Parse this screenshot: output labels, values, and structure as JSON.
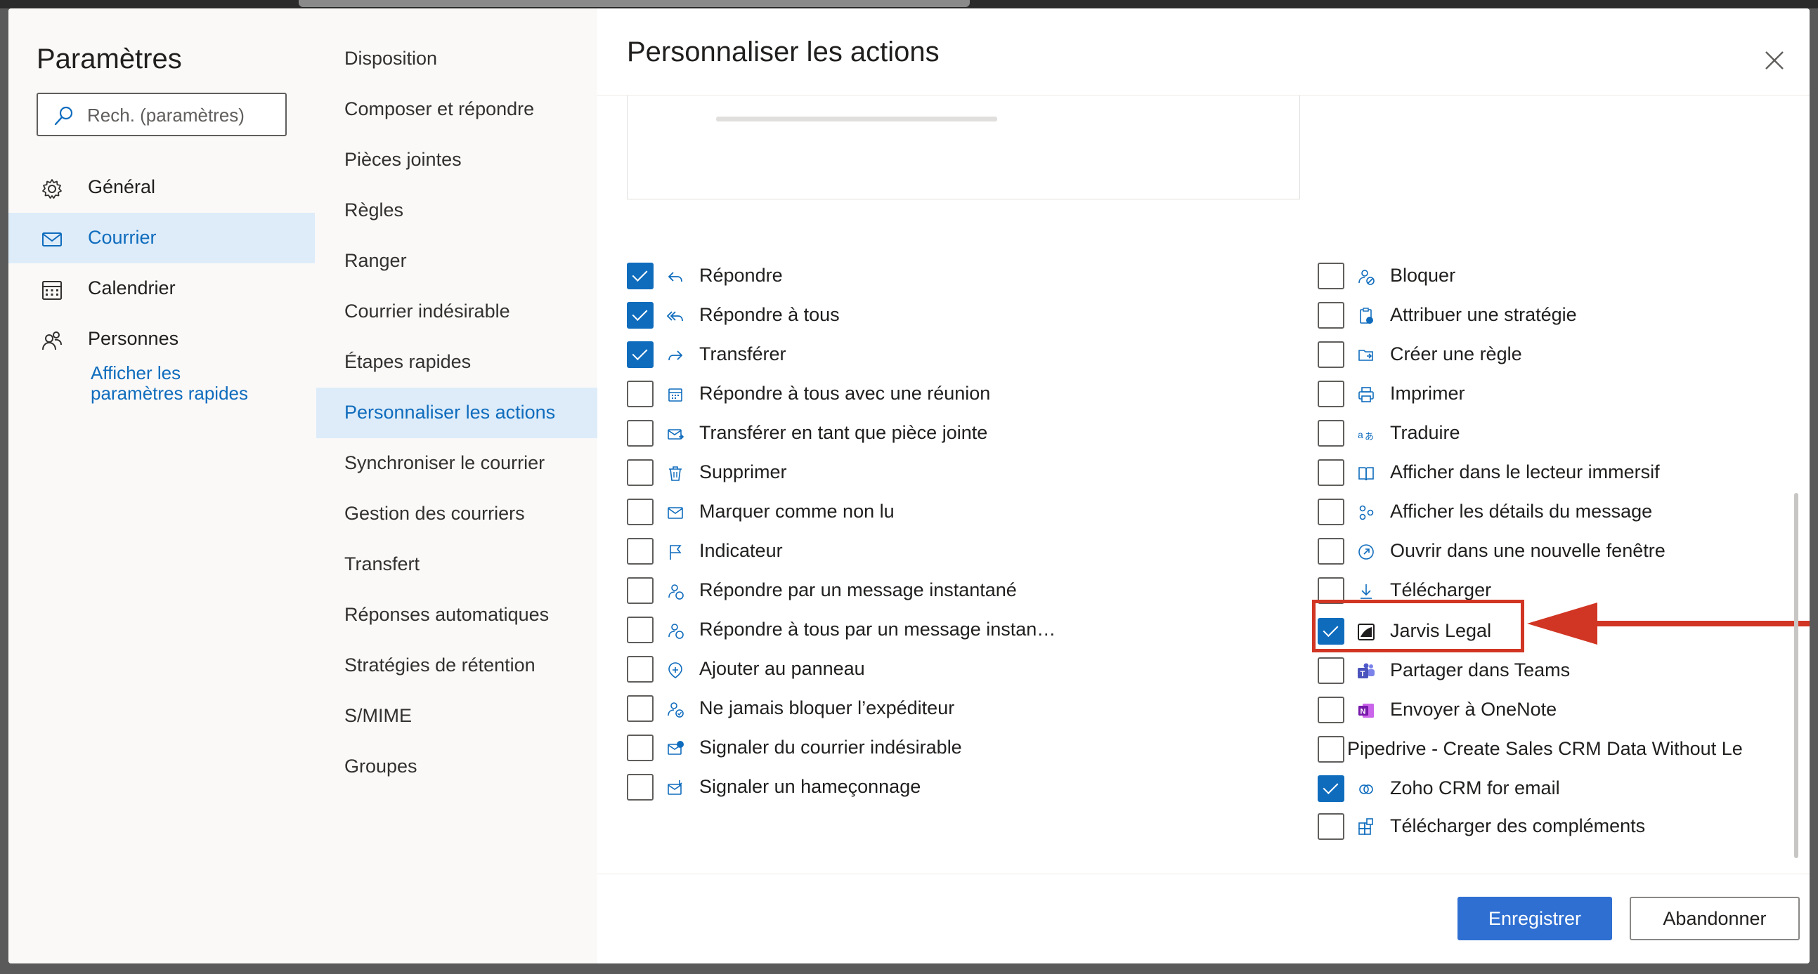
{
  "settings": {
    "title": "Paramètres",
    "search_placeholder": "Rech. (paramètres)",
    "nav": [
      {
        "label": "Général",
        "icon": "gear-icon"
      },
      {
        "label": "Courrier",
        "icon": "mail-icon",
        "active": true
      },
      {
        "label": "Calendrier",
        "icon": "calendar-icon"
      },
      {
        "label": "Personnes",
        "icon": "people-icon"
      }
    ],
    "quick_settings_link": "Afficher les paramètres rapides"
  },
  "mail_submenu": [
    "Disposition",
    "Composer et répondre",
    "Pièces jointes",
    "Règles",
    "Ranger",
    "Courrier indésirable",
    "Étapes rapides",
    "Personnaliser les actions",
    "Synchroniser le courrier",
    "Gestion des courriers",
    "Transfert",
    "Réponses automatiques",
    "Stratégies de rétention",
    "S/MIME",
    "Groupes"
  ],
  "active_submenu": "Personnaliser les actions",
  "panel": {
    "title": "Personnaliser les actions",
    "left_actions": [
      {
        "label": "Répondre",
        "checked": true,
        "icon": "reply-icon"
      },
      {
        "label": "Répondre à tous",
        "checked": true,
        "icon": "reply-all-icon"
      },
      {
        "label": "Transférer",
        "checked": true,
        "icon": "forward-icon"
      },
      {
        "label": "Répondre à tous avec une réunion",
        "checked": false,
        "icon": "meeting-icon"
      },
      {
        "label": "Transférer en tant que pièce jointe",
        "checked": false,
        "icon": "forward-attachment-icon"
      },
      {
        "label": "Supprimer",
        "checked": false,
        "icon": "trash-icon"
      },
      {
        "label": "Marquer comme non lu",
        "checked": false,
        "icon": "unread-mail-icon"
      },
      {
        "label": "Indicateur",
        "checked": false,
        "icon": "flag-icon"
      },
      {
        "label": "Répondre par un message instantané",
        "checked": false,
        "icon": "chat-reply-icon"
      },
      {
        "label": "Répondre à tous par un message instan…",
        "checked": false,
        "icon": "chat-reply-all-icon"
      },
      {
        "label": "Ajouter au panneau",
        "checked": false,
        "icon": "pin-icon"
      },
      {
        "label": "Ne jamais bloquer l’expéditeur",
        "checked": false,
        "icon": "safe-sender-icon"
      },
      {
        "label": "Signaler du courrier indésirable",
        "checked": false,
        "icon": "report-junk-icon"
      },
      {
        "label": "Signaler un hameçonnage",
        "checked": false,
        "icon": "report-phishing-icon"
      }
    ],
    "right_actions": [
      {
        "label": "Bloquer",
        "checked": false,
        "icon": "block-icon"
      },
      {
        "label": "Attribuer une stratégie",
        "checked": false,
        "icon": "policy-icon"
      },
      {
        "label": "Créer une règle",
        "checked": false,
        "icon": "rule-icon"
      },
      {
        "label": "Imprimer",
        "checked": false,
        "icon": "print-icon"
      },
      {
        "label": "Traduire",
        "checked": false,
        "icon": "translate-icon"
      },
      {
        "label": "Afficher dans le lecteur immersif",
        "checked": false,
        "icon": "immersive-reader-icon"
      },
      {
        "label": "Afficher les détails du message",
        "checked": false,
        "icon": "message-details-icon"
      },
      {
        "label": "Ouvrir dans une nouvelle fenêtre",
        "checked": false,
        "icon": "open-window-icon"
      },
      {
        "label": "Télécharger",
        "checked": false,
        "icon": "download-icon"
      },
      {
        "label": "Jarvis Legal",
        "checked": true,
        "icon": "jarvis-legal-icon"
      },
      {
        "label": "Partager dans Teams",
        "checked": false,
        "icon": "teams-icon"
      },
      {
        "label": "Envoyer à OneNote",
        "checked": false,
        "icon": "onenote-icon"
      },
      {
        "label": "Pipedrive - Create Sales CRM Data Without Le",
        "checked": false,
        "icon": ""
      },
      {
        "label": "Zoho CRM for email",
        "checked": true,
        "icon": "zoho-crm-icon"
      },
      {
        "label": "Télécharger des compléments",
        "checked": false,
        "icon": "add-ins-icon"
      }
    ],
    "save_label": "Enregistrer",
    "discard_label": "Abandonner"
  },
  "colors": {
    "accent": "#0f6cbd",
    "highlight": "#d13523",
    "primary_button": "#2f6fd1"
  }
}
